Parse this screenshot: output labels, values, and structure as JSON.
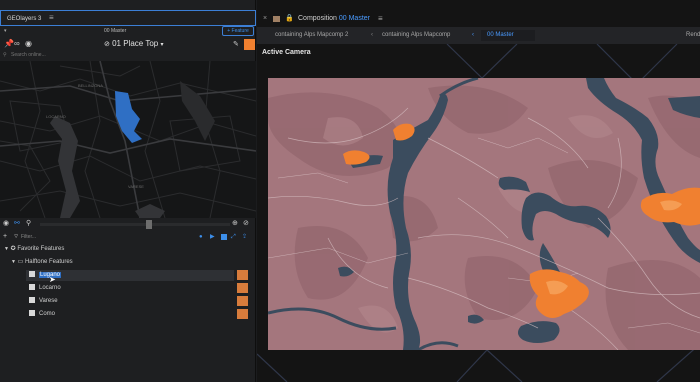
{
  "left_panel": {
    "title": "GEOlayers 3",
    "master_label": "00 Master",
    "feature_button": "+ Feature",
    "place_label": "01 Place Top",
    "search_placeholder": "Search online...",
    "filter_placeholder": "Filter..."
  },
  "map_labels": {
    "bellinzona": "BELLINZONA",
    "locarno": "LOCARNO",
    "varese": "VARESE"
  },
  "tree": {
    "favorite": "Favorite Features",
    "halftone": "Halftone Features",
    "items": [
      {
        "label": "Lugano",
        "selected": true
      },
      {
        "label": "Locarno",
        "selected": false
      },
      {
        "label": "Varese",
        "selected": false
      },
      {
        "label": "Como",
        "selected": false
      }
    ]
  },
  "right_panel": {
    "composition_label": "Composition",
    "composition_name": "00 Master",
    "breadcrumbs": [
      "containing Alps Mapcomp 2",
      "containing Alps Mapcomp",
      "00 Master"
    ],
    "render_label": "Rend",
    "viewer_label": "Active Camera"
  },
  "colors": {
    "accent": "#3c8eea",
    "feature_orange": "#f08030",
    "land": "#a4767d",
    "water": "#3b4c5e"
  }
}
